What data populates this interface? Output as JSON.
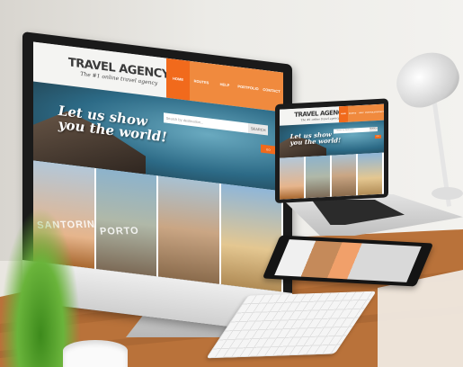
{
  "site": {
    "logo_title": "TRAVEL AGENCY",
    "logo_tagline": "The #1 online travel agency",
    "nav": [
      "HOME",
      "ROUTES",
      "HELP",
      "PORTFOLIO",
      "CONTACT"
    ],
    "hero_text_line1": "Let us show",
    "hero_text_line2": "you the world!",
    "search_placeholder": "Search by destination...",
    "search_button": "SEARCH",
    "go_button": "GO",
    "tiles": [
      {
        "label": "SANTORINI"
      },
      {
        "label": "PORTO"
      },
      {
        "label": ""
      },
      {
        "label": ""
      }
    ]
  },
  "colors": {
    "accent": "#f16a1c",
    "nav_inactive": "#f08a3e",
    "header_bg": "#f4f4f2"
  }
}
